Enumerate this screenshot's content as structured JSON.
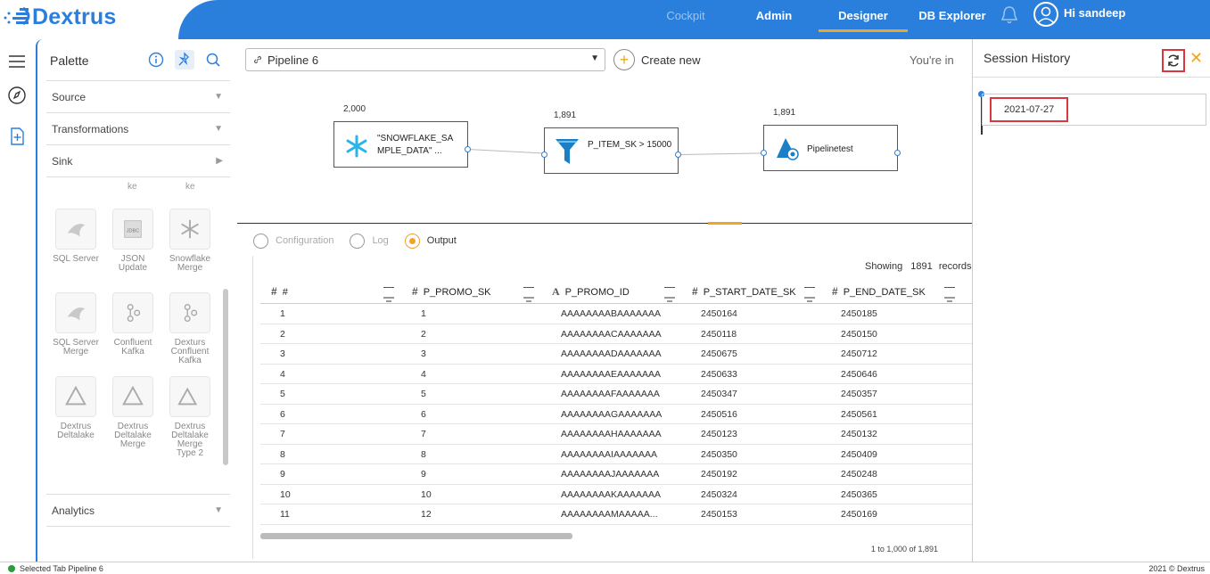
{
  "app": {
    "brand": "Dextrus"
  },
  "nav": {
    "items": [
      {
        "label": "Cockpit",
        "state": "dim"
      },
      {
        "label": "Admin",
        "state": "normal"
      },
      {
        "label": "Designer",
        "state": "active"
      },
      {
        "label": "DB Explorer",
        "state": "normal"
      }
    ],
    "user_greeting": "Hi sandeep"
  },
  "palette": {
    "title": "Palette",
    "sections": [
      "Source",
      "Transformations",
      "Sink",
      "Analytics"
    ],
    "partial_labels": [
      "ke",
      "ke"
    ],
    "tiles": [
      {
        "label": "SQL Server",
        "icon": "sql-server-icon"
      },
      {
        "label": "JSON Update",
        "icon": "json-update-icon"
      },
      {
        "label": "Snowflake Merge",
        "icon": "snowflake-merge-icon"
      },
      {
        "label": "SQL Server Merge",
        "icon": "sql-server-merge-icon"
      },
      {
        "label": "Confluent Kafka",
        "icon": "confluent-kafka-icon"
      },
      {
        "label": "Dexturs Confluent Kafka",
        "icon": "dexturs-confluent-kafka-icon"
      },
      {
        "label": "Dextrus Deltalake",
        "icon": "dextrus-deltalake-icon"
      },
      {
        "label": "Dextrus Deltalake Merge",
        "icon": "dextrus-deltalake-merge-icon"
      },
      {
        "label": "Dextrus Deltalake Merge Type 2",
        "icon": "dextrus-deltalake-merge-type2-icon"
      }
    ]
  },
  "toolbar": {
    "pipeline": "Pipeline 6",
    "create_new": "Create new",
    "youre_in": "You're in"
  },
  "flow": {
    "nodes": [
      {
        "count": "2,000",
        "label": "\"SNOWFLAKE_SA MPLE_DATA\" ..."
      },
      {
        "count": "1,891",
        "label": "P_ITEM_SK > 15000"
      },
      {
        "count": "1,891",
        "label": "Pipelinetest"
      }
    ]
  },
  "tabs": {
    "items": [
      {
        "label": "Configuration",
        "active": false
      },
      {
        "label": "Log",
        "active": false
      },
      {
        "label": "Output",
        "active": true
      }
    ]
  },
  "grid": {
    "showing_prefix": "Showing",
    "showing_count": "1891",
    "showing_suffix": "records",
    "columns": [
      {
        "type": "#",
        "name": "#"
      },
      {
        "type": "#",
        "name": "P_PROMO_SK"
      },
      {
        "type": "A",
        "name": "P_PROMO_ID"
      },
      {
        "type": "#",
        "name": "P_START_DATE_SK"
      },
      {
        "type": "#",
        "name": "P_END_DATE_SK"
      }
    ],
    "rows": [
      [
        "1",
        "1",
        "AAAAAAAABAAAAAAA",
        "2450164",
        "2450185"
      ],
      [
        "2",
        "2",
        "AAAAAAAACAAAAAAA",
        "2450118",
        "2450150"
      ],
      [
        "3",
        "3",
        "AAAAAAAADAAAAAAA",
        "2450675",
        "2450712"
      ],
      [
        "4",
        "4",
        "AAAAAAAAEAAAAAAA",
        "2450633",
        "2450646"
      ],
      [
        "5",
        "5",
        "AAAAAAAAFAAAAAAA",
        "2450347",
        "2450357"
      ],
      [
        "6",
        "6",
        "AAAAAAAAGAAAAAAA",
        "2450516",
        "2450561"
      ],
      [
        "7",
        "7",
        "AAAAAAAAHAAAAAAA",
        "2450123",
        "2450132"
      ],
      [
        "8",
        "8",
        "AAAAAAAAIAAAAAAA",
        "2450350",
        "2450409"
      ],
      [
        "9",
        "9",
        "AAAAAAAAJAAAAAAA",
        "2450192",
        "2450248"
      ],
      [
        "10",
        "10",
        "AAAAAAAAKAAAAAAA",
        "2450324",
        "2450365"
      ],
      [
        "11",
        "12",
        "AAAAAAAAMAAAAA...",
        "2450153",
        "2450169"
      ]
    ],
    "pager": "1 to 1,000 of 1,891"
  },
  "session": {
    "title": "Session History",
    "items": [
      "2021-07-27"
    ]
  },
  "status": {
    "left": "Selected Tab Pipeline 6",
    "right": "2021 © Dextrus"
  },
  "colors": {
    "brand_blue": "#2b7fdc",
    "accent_orange": "#f0a428",
    "highlight_red": "#d9393e"
  }
}
